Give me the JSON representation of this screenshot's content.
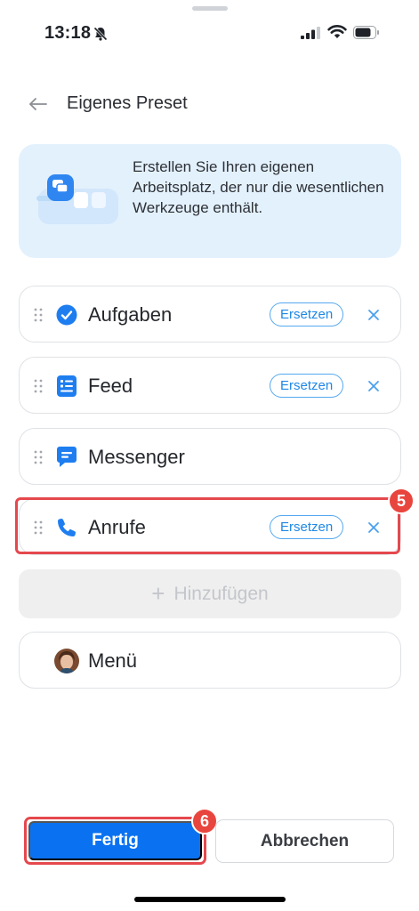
{
  "status_bar": {
    "time": "13:18"
  },
  "header": {
    "title": "Eigenes Preset"
  },
  "info": {
    "text": "Erstellen Sie Ihren eigenen Arbeitsplatz, der nur die wesentlichen Werkzeuge enthält."
  },
  "tools": [
    {
      "label": "Aufgaben",
      "icon": "tasks-check-icon",
      "replace_label": "Ersetzen"
    },
    {
      "label": "Feed",
      "icon": "feed-icon",
      "replace_label": "Ersetzen"
    },
    {
      "label": "Messenger",
      "icon": "messenger-icon"
    },
    {
      "label": "Anrufe",
      "icon": "phone-icon",
      "replace_label": "Ersetzen"
    }
  ],
  "add_label": "Hinzufügen",
  "add_symbol": "+",
  "menu": {
    "label": "Menü"
  },
  "annotations": {
    "badge_anrufe": "5",
    "badge_fertig": "6"
  },
  "footer": {
    "done_label": "Fertig",
    "cancel_label": "Abbrechen"
  },
  "colors": {
    "accent": "#0a72f0",
    "highlight": "#e5484d",
    "info_bg": "#e3f1fd"
  }
}
